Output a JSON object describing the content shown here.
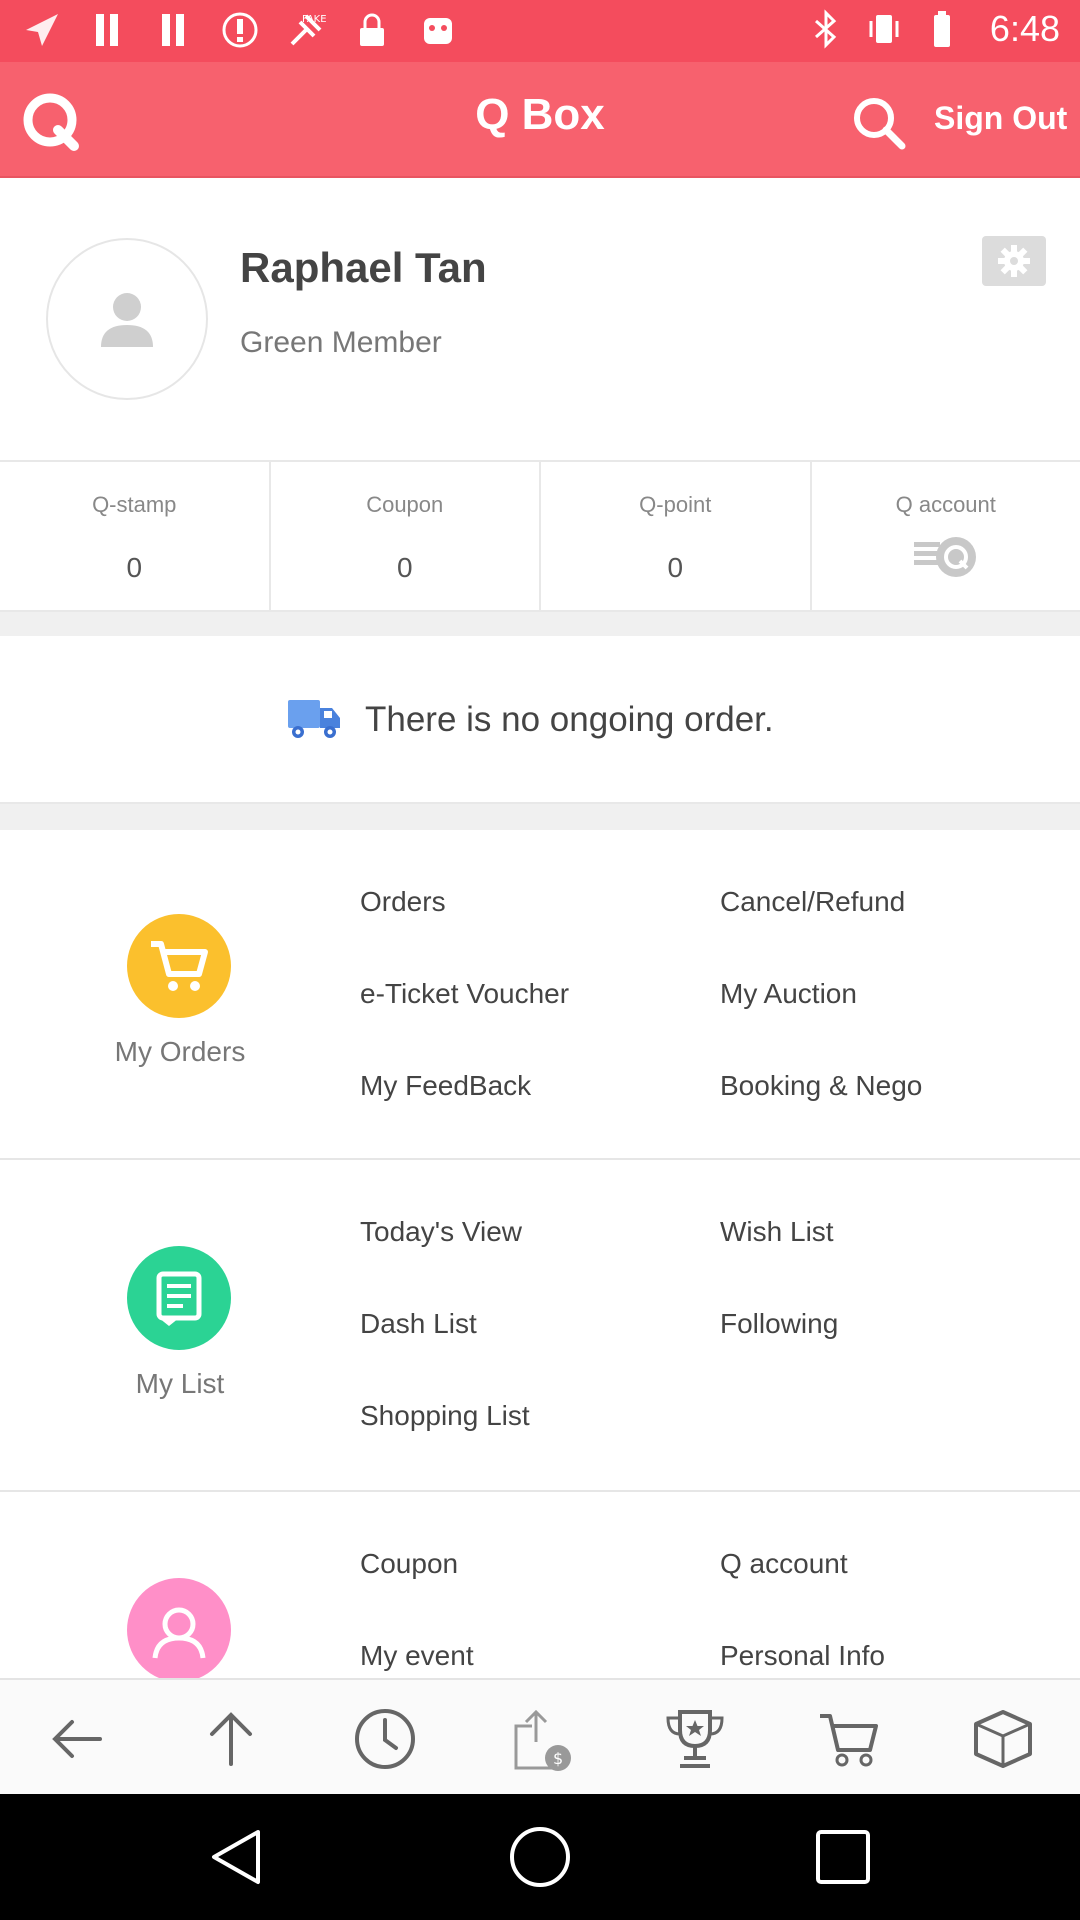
{
  "status_bar": {
    "time": "6:48"
  },
  "header": {
    "title": "Q Box",
    "sign_out": "Sign Out"
  },
  "profile": {
    "name": "Raphael Tan",
    "level": "Green Member"
  },
  "stats": [
    {
      "label": "Q-stamp",
      "value": "0"
    },
    {
      "label": "Coupon",
      "value": "0"
    },
    {
      "label": "Q-point",
      "value": "0"
    },
    {
      "label": "Q account",
      "icon": "q-account-icon"
    }
  ],
  "order_status": {
    "text": "There is no ongoing order."
  },
  "sections": {
    "orders": {
      "label": "My Orders",
      "icon_color": "#fbc02d",
      "links": [
        "Orders",
        "Cancel/Refund",
        "e-Ticket Voucher",
        "My Auction",
        "My FeedBack",
        "Booking & Nego"
      ]
    },
    "list": {
      "label": "My List",
      "icon_color": "#2bd394",
      "links": [
        "Today's View",
        "Wish List",
        "Dash List",
        "Following",
        "Shopping List"
      ]
    },
    "account": {
      "icon_color": "#ff8fc8",
      "links": [
        "Coupon",
        "Q account",
        "My event",
        "Personal Info"
      ]
    }
  },
  "toolbar": {
    "icons": [
      "back-arrow-icon",
      "up-arrow-icon",
      "clock-icon",
      "share-money-icon",
      "trophy-icon",
      "cart-icon",
      "box-icon"
    ]
  },
  "colors": {
    "header": "#f7616e",
    "status_bar": "#f44c5d"
  }
}
